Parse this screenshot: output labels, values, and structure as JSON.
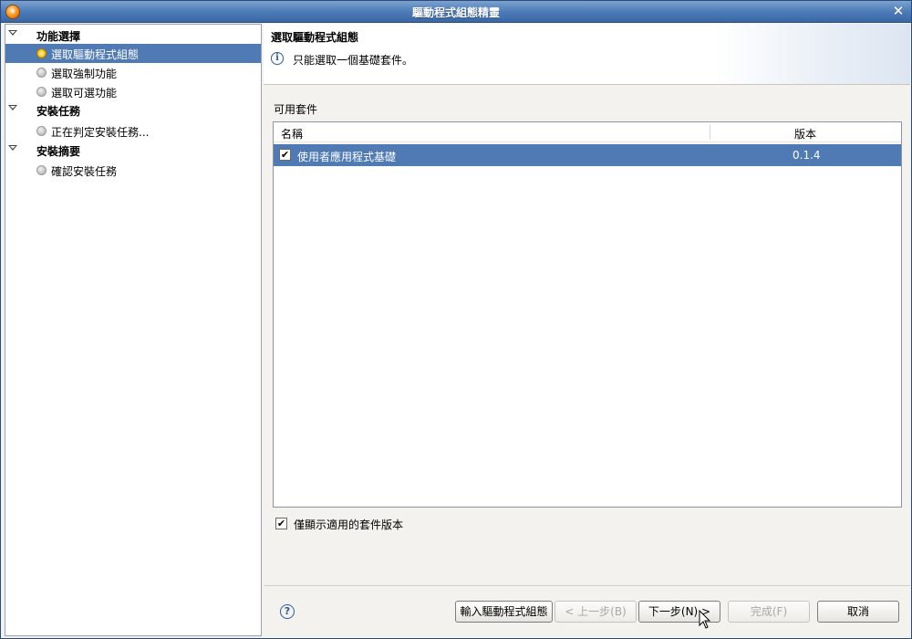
{
  "window": {
    "title": "驅動程式組態精靈",
    "close_symbol": "✕"
  },
  "tree": {
    "groups": [
      {
        "label": "功能選擇",
        "items": [
          "選取驅動程式組態",
          "選取強制功能",
          "選取可選功能"
        ]
      },
      {
        "label": "安裝任務",
        "items": [
          "正在判定安裝任務..."
        ]
      },
      {
        "label": "安裝摘要",
        "items": [
          "確認安裝任務"
        ]
      }
    ],
    "selected_item": "選取驅動程式組態"
  },
  "header": {
    "title": "選取驅動程式組態",
    "info_symbol": "i",
    "message": "只能選取一個基礎套件。"
  },
  "packages": {
    "label": "可用套件",
    "columns": {
      "name": "名稱",
      "version": "版本"
    },
    "rows": [
      {
        "name": "使用者應用程式基礎",
        "version": "0.1.4",
        "checked": true,
        "selected": true
      }
    ]
  },
  "filter": {
    "label": "僅顯示適用的套件版本",
    "checked": true,
    "check_symbol": "✔"
  },
  "footer": {
    "help_symbol": "?",
    "buttons": {
      "import": "輸入驅動程式組態",
      "back": "< 上一步(B)",
      "next": "下一步(N) >",
      "finish": "完成(F)",
      "cancel": "取消"
    }
  },
  "colors": {
    "selection": "#4f7ab3",
    "titlebar": "#4e7cb8"
  }
}
